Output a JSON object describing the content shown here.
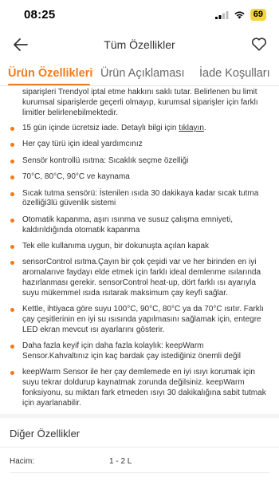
{
  "status": {
    "time": "08:25",
    "battery": "69"
  },
  "nav": {
    "title": "Tüm Özellikler"
  },
  "tabs": [
    {
      "label": "Ürün Özellikleri",
      "active": true
    },
    {
      "label": "Ürün Açıklaması",
      "active": false
    },
    {
      "label": "İade Koşulları",
      "active": false
    }
  ],
  "intro": "siparişleri Trendyol iptal etme hakkını saklı tutar. Belirlenen bu limit kurumsal siparişlerde geçerli olmayıp, kurumsal siparişler için farklı limitler belirlenebilmektedir.",
  "features": {
    "return_prefix": "15 gün içinde ücretsiz iade. Detaylı bilgi için ",
    "return_link": "tıklayın",
    "return_suffix": ".",
    "items": [
      "Her çay türü için ideal yardımcınız",
      "Sensör kontrollü ısıtma: Sıcaklık seçme özelliği",
      "70°C, 80°C, 90°C ve kaynama",
      "Sıcak tutma sensörü: İstenilen ısıda 30 dakikaya kadar sıcak tutma özelliği3lü güvenlik sistemi",
      "Otomatik kapanma, aşırı ısınma ve susuz çalışma emniyeti, kaldırıldığında otomatik kapanma",
      "Tek elle kullanıma uygun, bir dokunuşta açılan kapak",
      "sensorControl ısıtma.Çayın bir çok çeşidi var ve her birinden en iyi aromalarıve faydayı elde etmek için farklı ideal demlenme ısılarında hazırlanması gerekir. sensorControl heat-up, dört farklı ısı ayarıyla suyu mükemmel ısıda ısıtarak maksimum çay keyfi sağlar.",
      "Kettle, ihtiyaca göre suyu 100°C, 90°C, 80°C ya da 70°C ısıtır. Farklı çay çeşitlerinin en iyi su ısısında yapılmasını sağlamak için, entegre LED ekran mevcut ısı ayarlarını gösterir.",
      "Daha fazla keyif için daha fazla kolaylık: keepWarm Sensor.Kahvaltınız için kaç bardak çay istediğiniz önemli değil",
      "keepWarm Sensor ile her çay demlemede en iyi ısıyı korumak için suyu tekrar doldurup kaynatmak zorunda değilsiniz. keepWarm fonksiyonu, su miktarı fark etmeden ısıyı 30 dakikalığına sabit tutmak için ayarlanabilir."
    ]
  },
  "other": {
    "title": "Diğer Özellikler",
    "specs": [
      {
        "label": "Hacim:",
        "value": "1 - 2 L"
      }
    ]
  },
  "colors": {
    "accent": "#f27a1a",
    "battery": "#f5d33d"
  }
}
